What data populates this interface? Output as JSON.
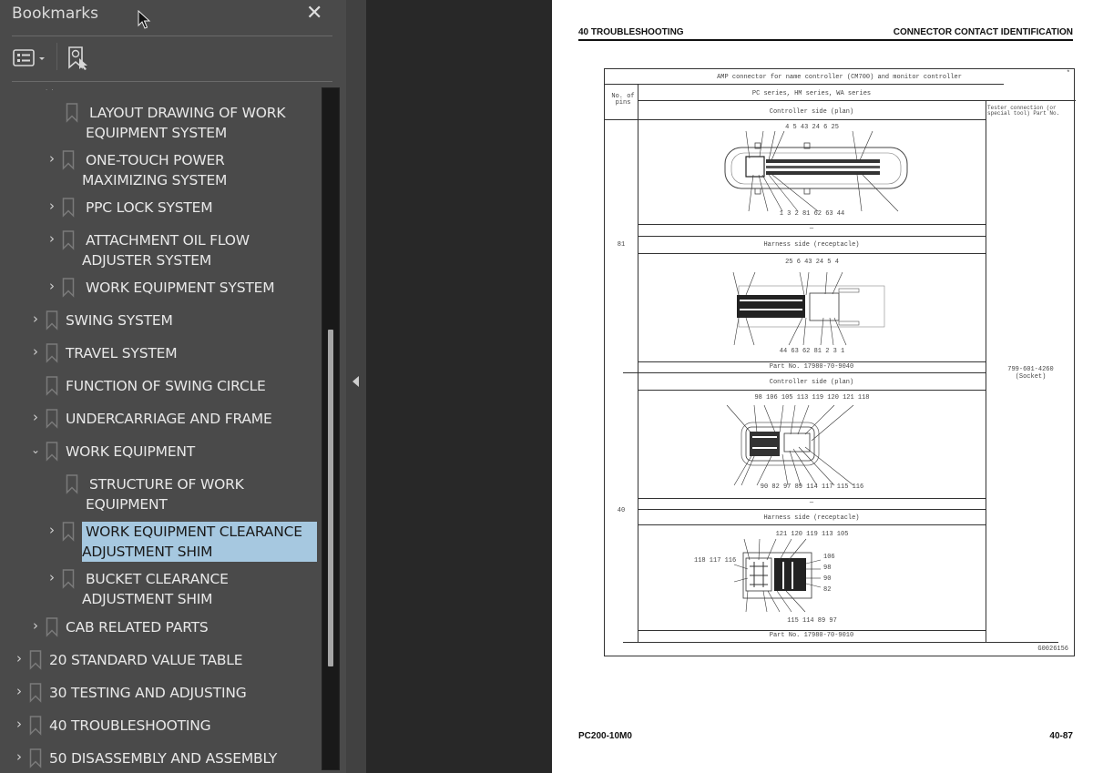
{
  "sidebar": {
    "title": "Bookmarks",
    "close_icon": "close-icon",
    "toolbar": {
      "options_icon": "bookmark-options-icon",
      "find_icon": "find-current-bookmark-icon"
    },
    "items": [
      {
        "label_line1": "LAYOUT DRAWING OF WORK",
        "label_line2": "EQUIPMENT SYSTEM",
        "level": 3,
        "expandable": false
      },
      {
        "label_line1": "ONE-TOUCH POWER",
        "label_line2": "MAXIMIZING SYSTEM",
        "level": 3,
        "expandable": true
      },
      {
        "label_line1": "PPC LOCK SYSTEM",
        "level": 3,
        "expandable": true
      },
      {
        "label_line1": "ATTACHMENT OIL FLOW",
        "label_line2": "ADJUSTER SYSTEM",
        "level": 3,
        "expandable": true
      },
      {
        "label_line1": "WORK EQUIPMENT SYSTEM",
        "level": 3,
        "expandable": true
      },
      {
        "label_line1": "SWING SYSTEM",
        "level": 2,
        "expandable": true
      },
      {
        "label_line1": "TRAVEL SYSTEM",
        "level": 2,
        "expandable": true
      },
      {
        "label_line1": "FUNCTION OF SWING CIRCLE",
        "level": 2,
        "expandable": false
      },
      {
        "label_line1": "UNDERCARRIAGE AND FRAME",
        "level": 2,
        "expandable": true
      },
      {
        "label_line1": "WORK EQUIPMENT",
        "level": 2,
        "expandable": true,
        "expanded": true
      },
      {
        "label_line1": "STRUCTURE OF WORK",
        "label_line2": "EQUIPMENT",
        "level": 3,
        "expandable": false
      },
      {
        "label_line1": "WORK EQUIPMENT CLEARANCE",
        "label_line2": "ADJUSTMENT SHIM",
        "level": 3,
        "expandable": true,
        "selected": true
      },
      {
        "label_line1": "BUCKET CLEARANCE",
        "label_line2": "ADJUSTMENT SHIM",
        "level": 3,
        "expandable": true
      },
      {
        "label_line1": "CAB RELATED PARTS",
        "level": 2,
        "expandable": true
      },
      {
        "label_line1": "20 STANDARD VALUE TABLE",
        "level": 1,
        "expandable": true
      },
      {
        "label_line1": "30 TESTING AND ADJUSTING",
        "level": 1,
        "expandable": true
      },
      {
        "label_line1": "40 TROUBLESHOOTING",
        "level": 1,
        "expandable": true
      },
      {
        "label_line1": "50 DISASSEMBLY AND ASSEMBLY",
        "level": 1,
        "expandable": true
      }
    ],
    "selected_color": "#a6c8e0"
  },
  "page": {
    "header_left": "40 TROUBLESHOOTING",
    "header_right": "CONNECTOR CONTACT IDENTIFICATION",
    "footer_left": "PC200-10M0",
    "footer_right": "40-87",
    "figure": {
      "title": "AMP connector for name controller (CM700) and monitor controller",
      "asterisk": "*",
      "pins_header": "No. of pins",
      "series_header": "PC series, HM series, WA series",
      "tester_header": "Tester connection (or special tool) Part No.",
      "sections": [
        {
          "pins": "81",
          "controller_side": "Controller side (plan)",
          "controller_pins_top": [
            "4",
            "5",
            "43",
            "24",
            "6",
            "25"
          ],
          "controller_pins_bottom": [
            "1",
            "3",
            "2",
            "81",
            "62",
            "63",
            "44"
          ],
          "dash": "—",
          "harness_side": "Harness side (receptacle)",
          "harness_pins_top": [
            "25",
            "6",
            "43",
            "24",
            "5",
            "4"
          ],
          "harness_pins_bottom": [
            "44",
            "63",
            "62",
            "81",
            "2",
            "3",
            "1"
          ],
          "part_no": "Part No. 17980-70-9040"
        },
        {
          "pins": "40",
          "controller_side": "Controller side (plan)",
          "controller_pins_top": [
            "98",
            "106",
            "105",
            "113",
            "119",
            "120",
            "121",
            "118"
          ],
          "controller_pins_bottom": [
            "90",
            "82",
            "97",
            "89",
            "114",
            "117",
            "115",
            "116"
          ],
          "dash": "—",
          "harness_side": "Harness side (receptacle)",
          "harness_pins_top": [
            "121",
            "120",
            "119",
            "113",
            "105"
          ],
          "harness_pins_left": [
            "118",
            "117",
            "116"
          ],
          "harness_pins_right": [
            "106",
            "98",
            "90",
            "82"
          ],
          "harness_pins_bottom": [
            "115",
            "114",
            "89",
            "97"
          ],
          "part_no": "Part No. 17980-70-9010"
        }
      ],
      "tester_part_no": "799-601-4260",
      "tester_part_type": "(Socket)",
      "figure_id": "G0026156"
    }
  }
}
